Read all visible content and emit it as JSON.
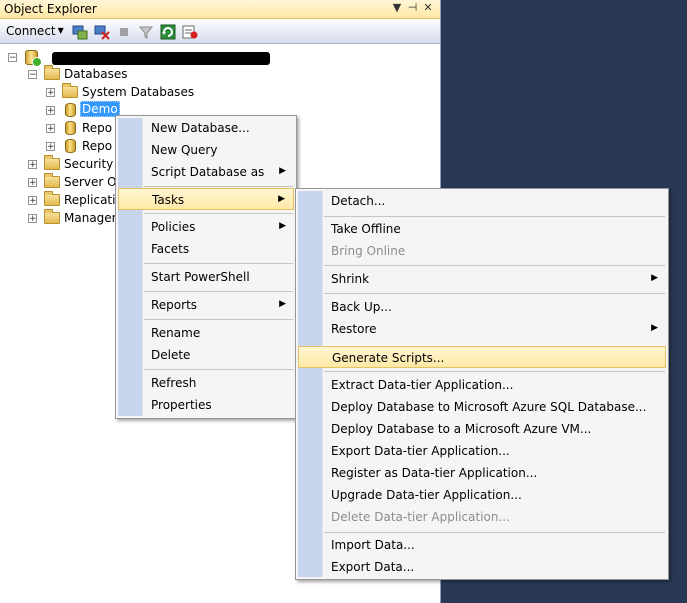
{
  "window": {
    "title": "Object Explorer",
    "buttons": [
      "▼",
      "⊣",
      "✕"
    ]
  },
  "toolbar": {
    "connect_label": "Connect",
    "connect_arrow": "▼"
  },
  "tree": {
    "databases": "Databases",
    "system_databases": "System Databases",
    "demo": "Demo",
    "repo1": "Repo",
    "repo2": "Repo",
    "security": "Security",
    "server_objects": "Server Ob",
    "replication": "Replicatio",
    "management": "Managem",
    "expand_minus": "−",
    "expand_plus": "+"
  },
  "context_menu": {
    "items": [
      "New Database...",
      "New Query",
      "Script Database as",
      "Tasks",
      "Policies",
      "Facets",
      "Start PowerShell",
      "Reports",
      "Rename",
      "Delete",
      "Refresh",
      "Properties"
    ],
    "submenu_arrow": "▶"
  },
  "tasks_menu": {
    "items": [
      "Detach...",
      "Take Offline",
      "Bring Online",
      "Shrink",
      "Back Up...",
      "Restore",
      "Generate Scripts...",
      "Extract Data-tier Application...",
      "Deploy Database to Microsoft Azure SQL Database...",
      "Deploy Database to a Microsoft Azure VM...",
      "Export Data-tier Application...",
      "Register as Data-tier Application...",
      "Upgrade Data-tier Application...",
      "Delete Data-tier Application...",
      "Import Data...",
      "Export Data..."
    ]
  }
}
